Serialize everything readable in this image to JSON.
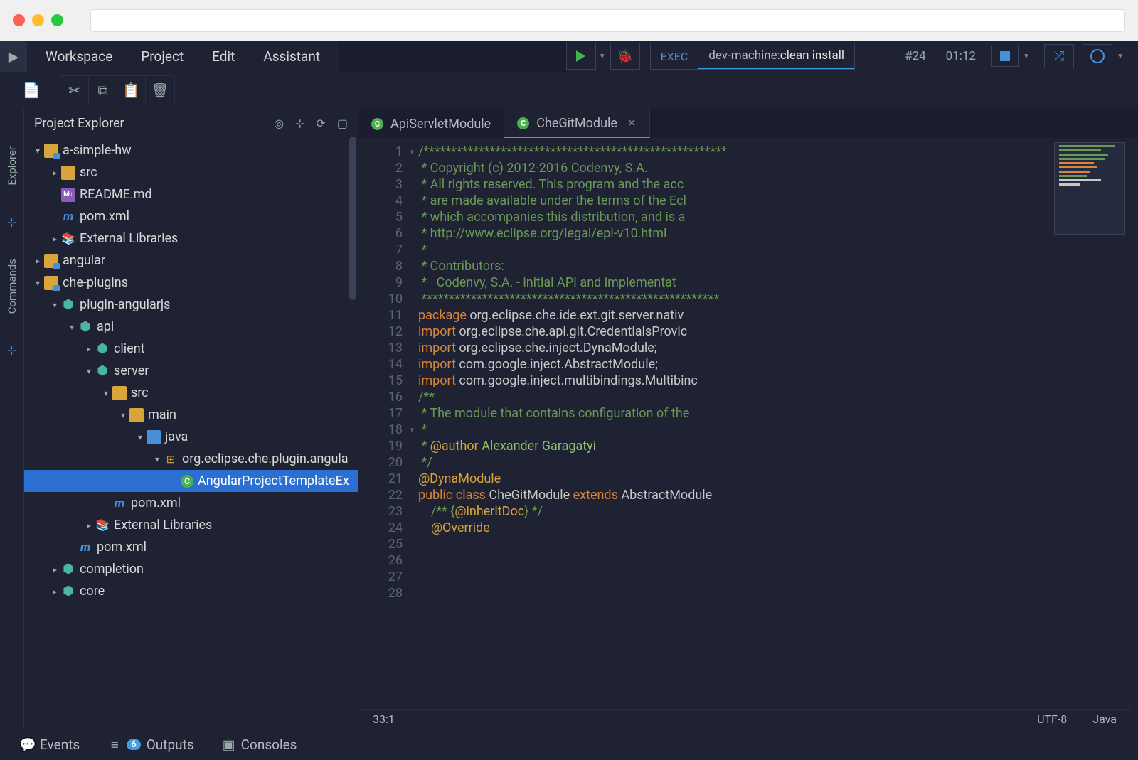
{
  "menu": {
    "items": [
      "Workspace",
      "Project",
      "Edit",
      "Assistant"
    ]
  },
  "exec": {
    "label": "EXEC",
    "machine": "dev-machine: ",
    "cmd": "clean install"
  },
  "run_stats": {
    "build": "#24",
    "time": "01:12"
  },
  "explorer": {
    "title": "Project Explorer",
    "tree": [
      {
        "d": 0,
        "tw": "▾",
        "ic": "proj",
        "label": "a-simple-hw"
      },
      {
        "d": 1,
        "tw": "▸",
        "ic": "fold",
        "label": "src"
      },
      {
        "d": 1,
        "tw": "",
        "ic": "md",
        "iclbl": "M↓",
        "label": "README.md"
      },
      {
        "d": 1,
        "tw": "",
        "ic": "mvn",
        "iclbl": "m",
        "label": "pom.xml"
      },
      {
        "d": 1,
        "tw": "▸",
        "ic": "lib",
        "iclbl": "📚",
        "label": "External Libraries"
      },
      {
        "d": 0,
        "tw": "▸",
        "ic": "proj",
        "label": "angular"
      },
      {
        "d": 0,
        "tw": "▾",
        "ic": "proj",
        "label": "che-plugins"
      },
      {
        "d": 1,
        "tw": "▾",
        "ic": "cube",
        "iclbl": "⬢",
        "label": "plugin-angularjs"
      },
      {
        "d": 2,
        "tw": "▾",
        "ic": "cube",
        "iclbl": "⬢",
        "label": "api"
      },
      {
        "d": 3,
        "tw": "▸",
        "ic": "cube",
        "iclbl": "⬢",
        "label": "client"
      },
      {
        "d": 3,
        "tw": "▾",
        "ic": "cube",
        "iclbl": "⬢",
        "label": "server"
      },
      {
        "d": 4,
        "tw": "▾",
        "ic": "fold",
        "label": "src"
      },
      {
        "d": 5,
        "tw": "▾",
        "ic": "fold",
        "label": "main"
      },
      {
        "d": 6,
        "tw": "▾",
        "ic": "foldb",
        "label": "java"
      },
      {
        "d": 7,
        "tw": "▾",
        "ic": "pkg",
        "iclbl": "⊞",
        "label": "org.eclipse.che.plugin.angula"
      },
      {
        "d": 8,
        "tw": "",
        "ic": "cls",
        "iclbl": "C",
        "label": "AngularProjectTemplateEx",
        "sel": true
      },
      {
        "d": 4,
        "tw": "",
        "ic": "mvn",
        "iclbl": "m",
        "label": "pom.xml"
      },
      {
        "d": 3,
        "tw": "▸",
        "ic": "lib",
        "iclbl": "📚",
        "label": "External Libraries"
      },
      {
        "d": 2,
        "tw": "",
        "ic": "mvn",
        "iclbl": "m",
        "label": "pom.xml"
      },
      {
        "d": 1,
        "tw": "▸",
        "ic": "cube",
        "iclbl": "⬢",
        "label": "completion"
      },
      {
        "d": 1,
        "tw": "▸",
        "ic": "cube",
        "iclbl": "⬢",
        "label": "core"
      }
    ]
  },
  "tabs": [
    {
      "label": "ApiServletModule",
      "active": false
    },
    {
      "label": "CheGitModule",
      "active": true,
      "close": true
    }
  ],
  "code_lines": [
    {
      "n": 1,
      "fold": true,
      "cls": "c-cm",
      "t": "/*******************************************************"
    },
    {
      "n": 2,
      "cls": "c-cm",
      "t": " * Copyright (c) 2012-2016 Codenvy, S.A."
    },
    {
      "n": 3,
      "cls": "c-cm",
      "t": " * All rights reserved. This program and the acc"
    },
    {
      "n": 4,
      "cls": "c-cm",
      "t": " * are made available under the terms of the Ecl"
    },
    {
      "n": 5,
      "cls": "c-cm",
      "t": " * which accompanies this distribution, and is a"
    },
    {
      "n": 6,
      "cls": "c-cm",
      "t": " * http://www.eclipse.org/legal/epl-v10.html"
    },
    {
      "n": 7,
      "cls": "c-cm",
      "t": " *"
    },
    {
      "n": 8,
      "cls": "c-cm",
      "t": " * Contributors:"
    },
    {
      "n": 9,
      "cls": "c-cm",
      "t": " *   Codenvy, S.A. - initial API and implementat"
    },
    {
      "n": 10,
      "cls": "c-cm",
      "t": " ******************************************************"
    },
    {
      "n": 11,
      "html": "<span class='c-kw'>package</span> org.eclipse.che.ide.ext.git.server.nativ"
    },
    {
      "n": 12,
      "t": ""
    },
    {
      "n": 13,
      "html": "<span class='c-kw'>import</span> org.eclipse.che.api.git.CredentialsProvic"
    },
    {
      "n": 14,
      "html": "<span class='c-kw'>import</span> org.eclipse.che.inject.DynaModule;"
    },
    {
      "n": 15,
      "html": "<span class='c-kw'>import</span> com.google.inject.AbstractModule;"
    },
    {
      "n": 16,
      "html": "<span class='c-kw'>import</span> com.google.inject.multibindings.Multibinc"
    },
    {
      "n": 17,
      "t": ""
    },
    {
      "n": 18,
      "fold": true,
      "cls": "c-cm",
      "t": "/**"
    },
    {
      "n": 19,
      "cls": "c-cm",
      "t": " * The module that contains configuration of the"
    },
    {
      "n": 20,
      "cls": "c-cm",
      "t": " *"
    },
    {
      "n": 21,
      "html": "<span class='c-cm'> * </span><span class='c-an'>@author</span> <span class='c-au'>Alexander Garagatyi</span>"
    },
    {
      "n": 22,
      "cls": "c-cm",
      "t": " */"
    },
    {
      "n": 23,
      "cls": "c-an",
      "t": "@DynaModule"
    },
    {
      "n": 24,
      "html": "<span class='c-kw'>public</span> <span class='c-kw'>class</span> CheGitModule <span class='c-kw'>extends</span> AbstractModule"
    },
    {
      "n": 25,
      "t": ""
    },
    {
      "n": 26,
      "html": "    <span class='c-cm'>/** {</span><span class='c-an'>@inheritDoc</span><span class='c-cm'>} */</span>"
    },
    {
      "n": 27,
      "cls": "c-an",
      "t": "    @Override"
    },
    {
      "n": 28,
      "t": ""
    }
  ],
  "status": {
    "pos": "33:1",
    "enc": "UTF-8",
    "lang": "Java"
  },
  "bottom": {
    "events": "Events",
    "outputs": "Outputs",
    "outputs_badge": "6",
    "consoles": "Consoles"
  },
  "siderails": {
    "explorer": "Explorer",
    "commands": "Commands"
  }
}
